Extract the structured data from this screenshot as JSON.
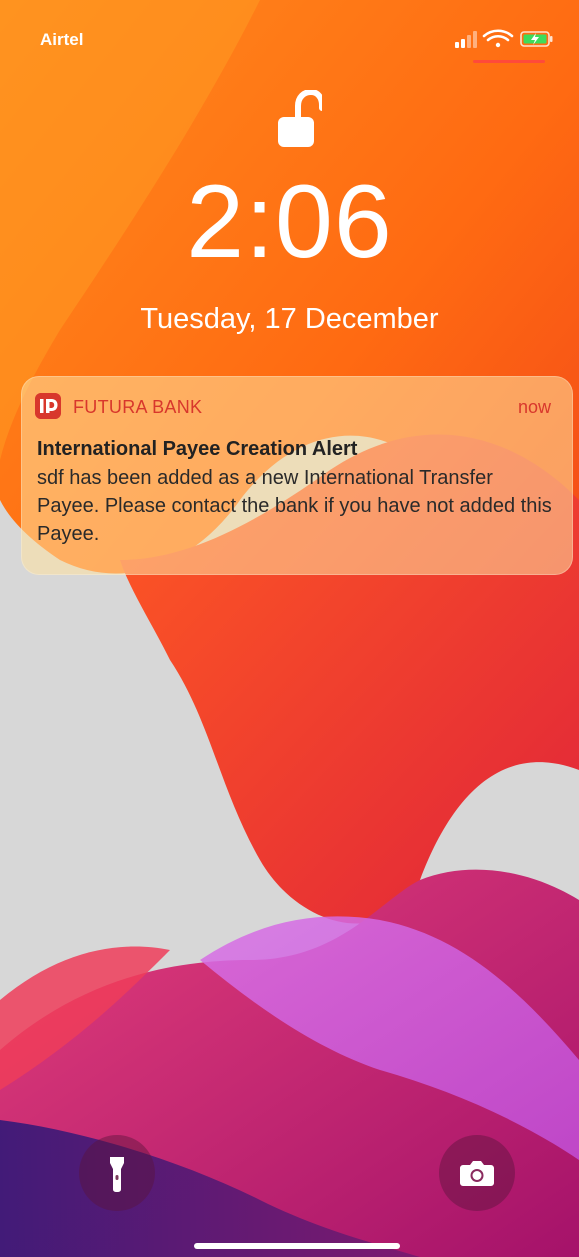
{
  "status_bar": {
    "carrier": "Airtel",
    "icons": [
      "signal-icon",
      "wifi-icon",
      "battery-charging-icon"
    ]
  },
  "lock_screen": {
    "lock_icon": "unlock-icon",
    "time": "2:06",
    "date": "Tuesday, 17 December"
  },
  "notification": {
    "app_name": "FUTURA BANK",
    "time": "now",
    "title": "International Payee Creation Alert",
    "body": "sdf has been added as a new International Transfer Payee. Please contact the bank if you have not added this Payee.",
    "accent_color": "#d8372c"
  },
  "quick_actions": [
    {
      "name": "flashlight",
      "icon": "flashlight-icon"
    },
    {
      "name": "camera",
      "icon": "camera-icon"
    }
  ],
  "colors": {
    "wallpaper_orange": "#ff7a1a",
    "wallpaper_red": "#ee2f2f",
    "wallpaper_magenta": "#c51d72",
    "wallpaper_grey": "#d6d6d6",
    "battery_green": "#3ddc5c"
  }
}
